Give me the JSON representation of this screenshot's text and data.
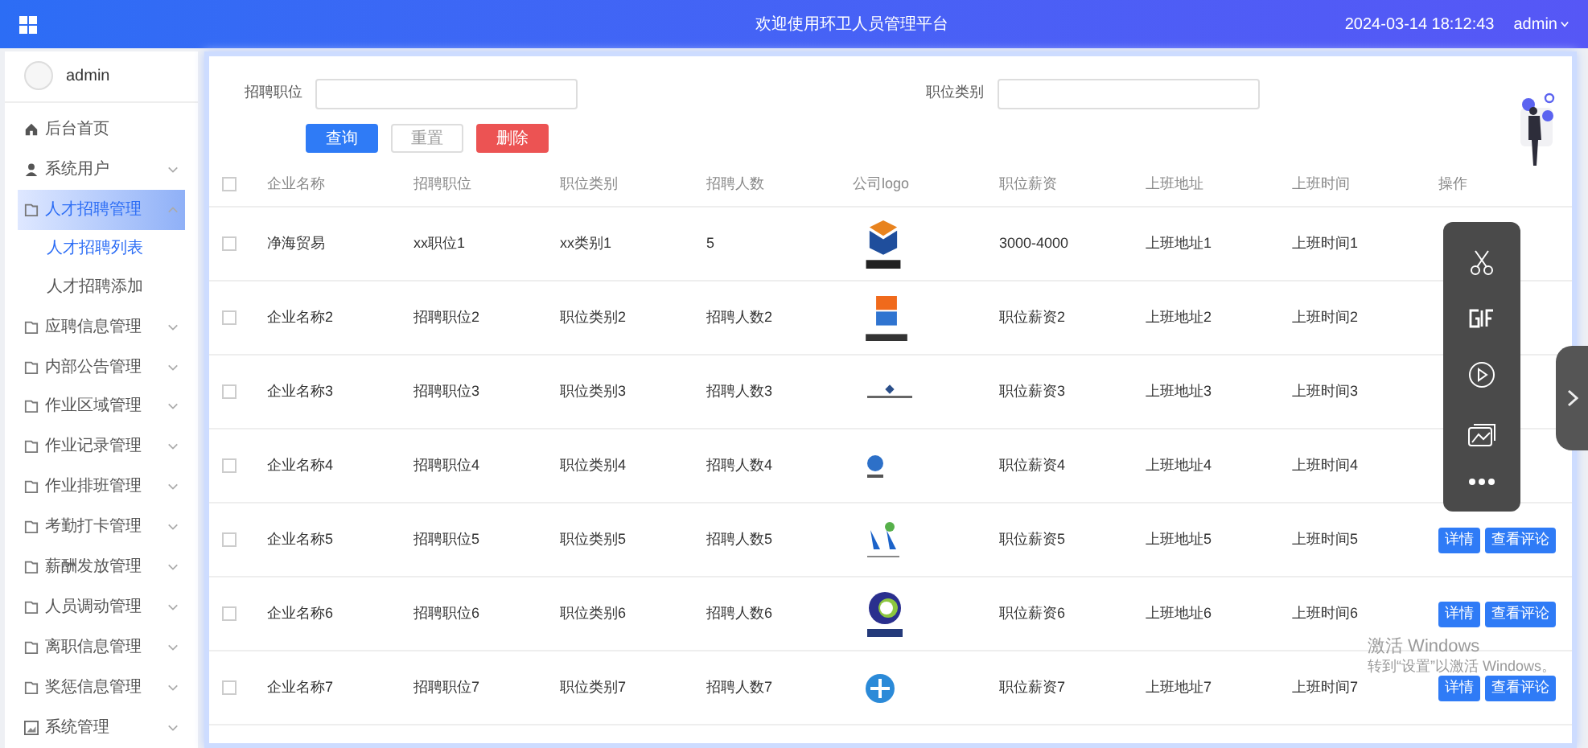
{
  "header": {
    "title": "欢迎使用环卫人员管理平台",
    "datetime": "2024-03-14 18:12:43",
    "user": "admin"
  },
  "sidebar": {
    "user": "admin",
    "items": [
      {
        "label": "后台首页",
        "selected": false
      },
      {
        "label": "系统用户",
        "selected": false,
        "expanded": false
      },
      {
        "label": "人才招聘管理",
        "selected": true,
        "expanded": true,
        "children": [
          {
            "label": "人才招聘列表",
            "selected": true
          },
          {
            "label": "人才招聘添加",
            "selected": false
          }
        ]
      },
      {
        "label": "应聘信息管理",
        "selected": false,
        "expanded": false
      },
      {
        "label": "内部公告管理",
        "selected": false,
        "expanded": false
      },
      {
        "label": "作业区域管理",
        "selected": false,
        "expanded": false
      },
      {
        "label": "作业记录管理",
        "selected": false,
        "expanded": false
      },
      {
        "label": "作业排班管理",
        "selected": false,
        "expanded": false
      },
      {
        "label": "考勤打卡管理",
        "selected": false,
        "expanded": false
      },
      {
        "label": "薪酬发放管理",
        "selected": false,
        "expanded": false
      },
      {
        "label": "人员调动管理",
        "selected": false,
        "expanded": false
      },
      {
        "label": "离职信息管理",
        "selected": false,
        "expanded": false
      },
      {
        "label": "奖惩信息管理",
        "selected": false,
        "expanded": false
      },
      {
        "label": "系统管理",
        "selected": false,
        "expanded": false
      }
    ]
  },
  "filters": [
    {
      "label": "招聘职位"
    },
    {
      "label": "职位类别"
    }
  ],
  "buttons": [
    {
      "label": "查询",
      "kind": "primary"
    },
    {
      "label": "重置",
      "kind": "default"
    },
    {
      "label": "删除",
      "kind": "danger"
    }
  ],
  "table": {
    "select_all_checked": false,
    "columns": [
      "企业名称",
      "招聘职位",
      "职位类别",
      "招聘人数",
      "公司logo",
      "职位薪资",
      "上班地址",
      "上班时间",
      "操作"
    ],
    "rows": [
      {
        "checked": false,
        "cells": [
          "净海贸易",
          "xx职位1",
          "xx类别1",
          "5",
          {
            "kind": "picture"
          },
          "3000-4000",
          "上班地址1",
          "上班时间1"
        ]
      },
      {
        "checked": false,
        "cells": [
          "企业名称2",
          "招聘职位2",
          "职位类别2",
          "招聘人数2",
          {
            "kind": "picture"
          },
          "职位薪资2",
          "上班地址2",
          "上班时间2"
        ]
      },
      {
        "checked": false,
        "cells": [
          "企业名称3",
          "招聘职位3",
          "职位类别3",
          "招聘人数3",
          {
            "kind": "picture"
          },
          "职位薪资3",
          "上班地址3",
          "上班时间3"
        ]
      },
      {
        "checked": false,
        "cells": [
          "企业名称4",
          "招聘职位4",
          "职位类别4",
          "招聘人数4",
          {
            "kind": "picture"
          },
          "职位薪资4",
          "上班地址4",
          "上班时间4"
        ]
      },
      {
        "checked": false,
        "cells": [
          "企业名称5",
          "招聘职位5",
          "职位类别5",
          "招聘人数5",
          {
            "kind": "picture"
          },
          "职位薪资5",
          "上班地址5",
          "上班时间5"
        ],
        "actions": [
          "详情",
          "查看评论"
        ]
      },
      {
        "checked": false,
        "cells": [
          "企业名称6",
          "招聘职位6",
          "职位类别6",
          "招聘人数6",
          {
            "kind": "picture"
          },
          "职位薪资6",
          "上班地址6",
          "上班时间6"
        ],
        "actions": [
          "详情",
          "查看评论"
        ]
      },
      {
        "checked": false,
        "cells": [
          "企业名称7",
          "招聘职位7",
          "职位类别7",
          "招聘人数7",
          {
            "kind": "picture"
          },
          "职位薪资7",
          "上班地址7",
          "上班时间7"
        ],
        "actions": [
          "详情",
          "查看评论"
        ]
      }
    ]
  },
  "activation_notice": {
    "title": "激活 Windows",
    "subtitle": "转到“设置”以激活 Windows。"
  }
}
